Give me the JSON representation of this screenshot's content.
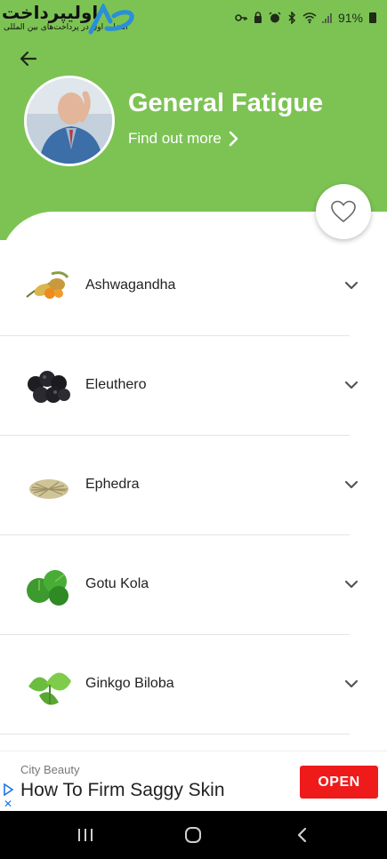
{
  "status_bar": {
    "logo_text": "اولیپرداخت",
    "logo_subtext": "انتخاب اول در پرداخت‌های بین المللی",
    "battery": "91%"
  },
  "header": {
    "title": "General Fatigue",
    "find_out_more": "Find out more"
  },
  "remedies": [
    {
      "name": "Ashwagandha"
    },
    {
      "name": "Eleuthero"
    },
    {
      "name": "Ephedra"
    },
    {
      "name": "Gotu Kola"
    },
    {
      "name": "Ginkgo Biloba"
    }
  ],
  "ad": {
    "advertiser": "City Beauty",
    "headline": "How To Firm Saggy Skin",
    "cta": "OPEN"
  },
  "colors": {
    "header_green": "#7cc354",
    "ad_button_red": "#ef1b1b"
  }
}
